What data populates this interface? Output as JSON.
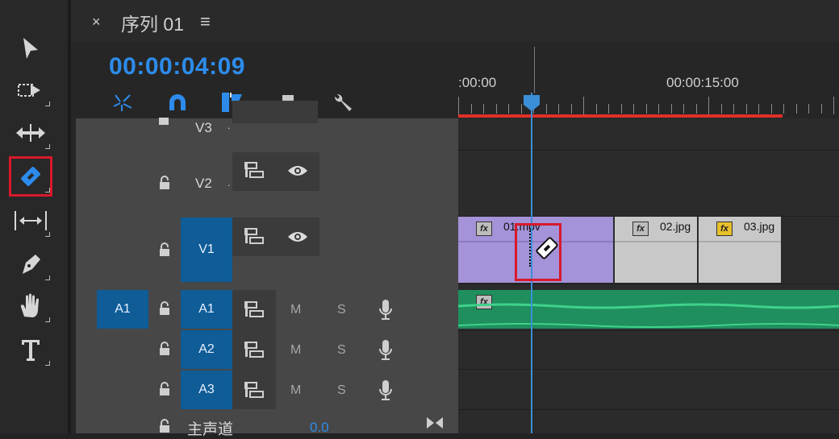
{
  "tools": [
    {
      "name": "selection-tool",
      "icon": "arrow-pointer"
    },
    {
      "name": "track-select-tool",
      "icon": "dashed-arrow"
    },
    {
      "name": "ripple-edit-tool",
      "icon": "horizontal-arrows"
    },
    {
      "name": "razor-tool",
      "icon": "razor-blade",
      "selected": true
    },
    {
      "name": "slip-tool",
      "icon": "slip-bracket"
    },
    {
      "name": "pen-tool",
      "icon": "pen"
    },
    {
      "name": "hand-tool",
      "icon": "hand"
    },
    {
      "name": "type-tool",
      "icon": "T"
    }
  ],
  "sequence": {
    "close_glyph": "×",
    "title": "序列 01",
    "menu_glyph": "≡",
    "timecode": "00:00:04:09"
  },
  "controls": [
    {
      "name": "nest-toggle",
      "icon": "sequence-nest-icon"
    },
    {
      "name": "snap-toggle",
      "icon": "magnet-icon"
    },
    {
      "name": "linked-selection",
      "icon": "linked-selection-icon"
    },
    {
      "name": "add-marker",
      "icon": "marker-icon"
    },
    {
      "name": "timeline-settings",
      "icon": "wrench-icon"
    }
  ],
  "ruler": {
    "left_label": ":00:00",
    "mid_label": "00:00:15:00"
  },
  "tracks": {
    "v3": {
      "label": "V3"
    },
    "v2": {
      "label": "V2"
    },
    "v1": {
      "label": "V1"
    },
    "a1_source": {
      "label": "A1"
    },
    "a1": {
      "label": "A1",
      "m": "M",
      "s": "S"
    },
    "a2": {
      "label": "A2",
      "m": "M",
      "s": "S"
    },
    "a3": {
      "label": "A3",
      "m": "M",
      "s": "S"
    },
    "master": {
      "label": "主声道",
      "value": "0.0"
    },
    "dot": "."
  },
  "clips": {
    "clip1": {
      "name": "01.mov",
      "fx": "fx"
    },
    "clip2": {
      "name": "02.jpg",
      "fx": "fx"
    },
    "clip3": {
      "name": "03.jpg",
      "fx": "fx"
    },
    "audio1": {
      "fx": "fx"
    }
  },
  "colors": {
    "timecode_blue": "#2d8ceb",
    "track_target_blue": "#0f5c97",
    "video_clip_purple": "#a493d8",
    "image_clip_gray": "#c8c8c8",
    "audio_clip_green": "#1f8f5e",
    "work_area_red": "#e0302a",
    "playhead_blue": "#3a8fd8",
    "highlight_red": "#d8192a"
  }
}
